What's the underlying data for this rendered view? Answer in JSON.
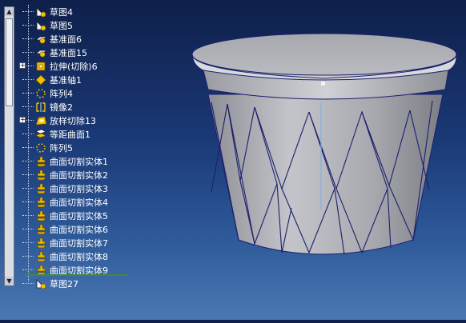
{
  "tree": {
    "items": [
      {
        "label": "草图4",
        "icon": "sketch-icon"
      },
      {
        "label": "草图5",
        "icon": "sketch-icon"
      },
      {
        "label": "基准面6",
        "icon": "plane-icon"
      },
      {
        "label": "基准面15",
        "icon": "plane-icon"
      },
      {
        "label": "拉伸(切除)6",
        "icon": "extrude-cut-icon",
        "expandable": true
      },
      {
        "label": "基准轴1",
        "icon": "axis-icon"
      },
      {
        "label": "阵列4",
        "icon": "pattern-icon"
      },
      {
        "label": "镜像2",
        "icon": "mirror-icon"
      },
      {
        "label": "放样切除13",
        "icon": "loft-cut-icon",
        "expandable": true
      },
      {
        "label": "等距曲面1",
        "icon": "offset-surface-icon"
      },
      {
        "label": "阵列5",
        "icon": "pattern-icon"
      },
      {
        "label": "曲面切割实体1",
        "icon": "surface-cut-icon"
      },
      {
        "label": "曲面切割实体2",
        "icon": "surface-cut-icon"
      },
      {
        "label": "曲面切割实体3",
        "icon": "surface-cut-icon"
      },
      {
        "label": "曲面切割实体4",
        "icon": "surface-cut-icon"
      },
      {
        "label": "曲面切割实体5",
        "icon": "surface-cut-icon"
      },
      {
        "label": "曲面切割实体6",
        "icon": "surface-cut-icon"
      },
      {
        "label": "曲面切割实体7",
        "icon": "surface-cut-icon"
      },
      {
        "label": "曲面切割实体8",
        "icon": "surface-cut-icon"
      },
      {
        "label": "曲面切割实体9",
        "icon": "surface-cut-icon"
      },
      {
        "label": "草图27",
        "icon": "sketch-icon"
      }
    ]
  },
  "colors": {
    "background_top": "#0e1f4a",
    "background_bottom": "#4a78b2",
    "model_edge": "#1c1f6b",
    "model_face": "#a9abb1",
    "axis_line": "#7fb2e6"
  }
}
